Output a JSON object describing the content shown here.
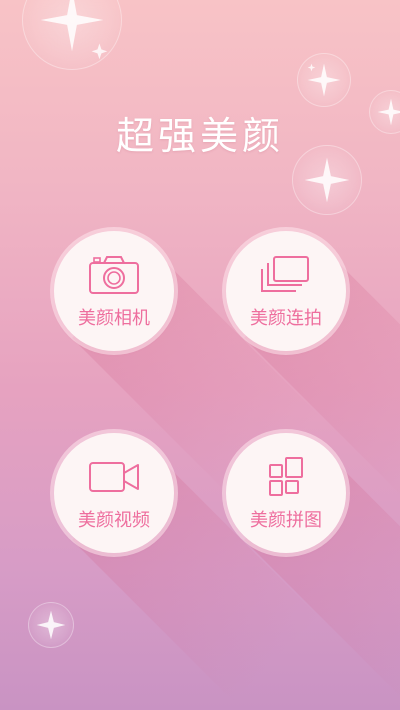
{
  "app": {
    "title": "超强美颜"
  },
  "menu": [
    {
      "label": "美颜相机",
      "icon": "camera-icon"
    },
    {
      "label": "美颜连拍",
      "icon": "burst-photos-icon"
    },
    {
      "label": "美颜视频",
      "icon": "video-camera-icon"
    },
    {
      "label": "美颜拼图",
      "icon": "collage-grid-icon"
    }
  ],
  "colors": {
    "accent": "#ee6e9e",
    "button_bg": "#fdf5f5",
    "title": "#ffffff"
  }
}
